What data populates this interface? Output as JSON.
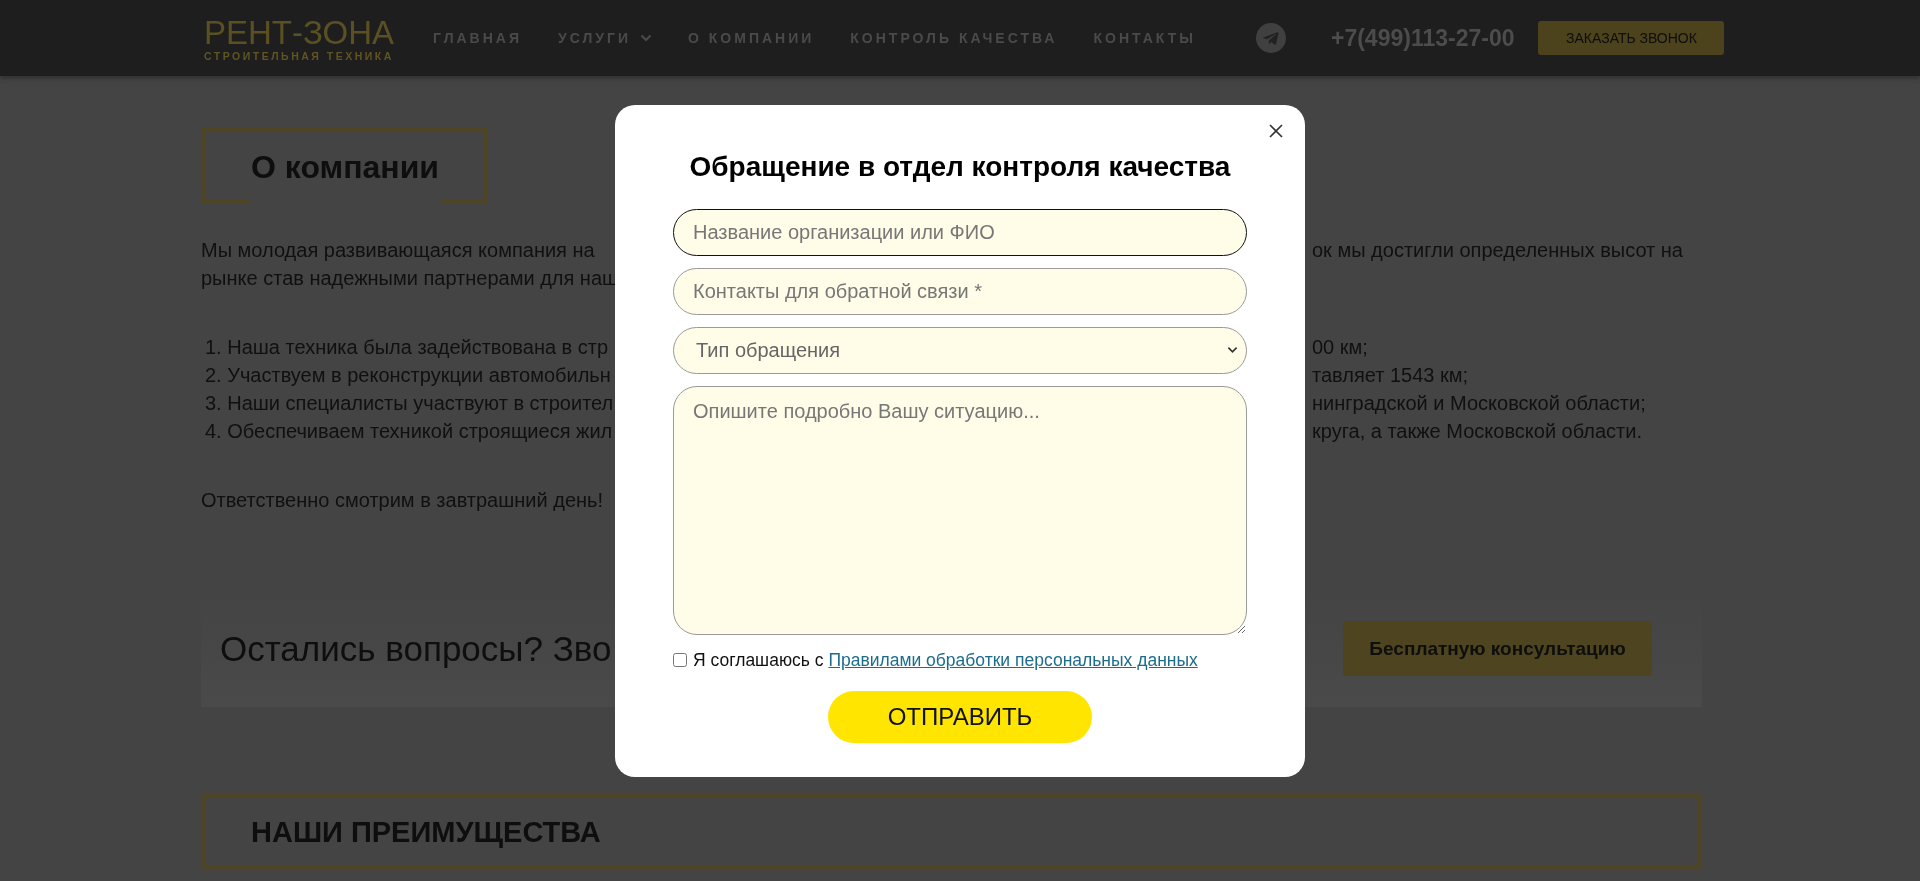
{
  "header": {
    "logo": {
      "name": "РЕНТ-ЗОНА",
      "tagline": "СТРОИТЕЛЬНАЯ ТЕХНИКА"
    },
    "nav": [
      {
        "label": "ГЛАВНАЯ",
        "has_dropdown": false
      },
      {
        "label": "УСЛУГИ",
        "has_dropdown": true
      },
      {
        "label": "О КОМПАНИИ",
        "has_dropdown": false
      },
      {
        "label": "КОНТРОЛЬ КАЧЕСТВА",
        "has_dropdown": false
      },
      {
        "label": "КОНТАКТЫ",
        "has_dropdown": false
      }
    ],
    "phone": "+7(499)113-27-00",
    "callback_button": "ЗАКАЗАТЬ ЗВОНОК"
  },
  "about": {
    "heading": "О компании",
    "intro_lines": [
      {
        "left": "Мы молодая развивающаяся компания на",
        "right": "ок мы достигли определенных высот на"
      },
      {
        "left": "рынке став надежными партнерами для наш"
      }
    ],
    "list_lines": [
      {
        "left": "1. Наша техника была задействована в стр",
        "right": "00 км;"
      },
      {
        "left": "2. Участвуем в реконструкции автомобильн",
        "right": "тавляет 1543 км;"
      },
      {
        "left": "3. Наши специалисты участвуют в строител",
        "right": "нинградской и Московской области;"
      },
      {
        "left": "4. Обеспечиваем техникой строящиеся жил",
        "right": "круга, а также Московской области."
      }
    ],
    "closing": "Ответственно смотрим в завтрашний день!"
  },
  "cta": {
    "text": "Остались вопросы? Зво",
    "button": "Бесплатную консультацию"
  },
  "advantages": {
    "heading": "НАШИ ПРЕИМУЩЕСТВА"
  },
  "modal": {
    "title": "Обращение в отдел контроля качества",
    "fields": [
      {
        "kind": "input",
        "placeholder": "Название организации или ФИО",
        "focused": true
      },
      {
        "kind": "input",
        "placeholder": "Контакты для обратной связи *",
        "focused": false
      },
      {
        "kind": "select",
        "value": "Тип обращения",
        "focused": false
      },
      {
        "kind": "textarea",
        "placeholder": "Опишите подробно Вашу ситуацию...",
        "focused": false
      }
    ],
    "consent": {
      "text": "Я соглашаюсь с",
      "link": "Правилами обработки персональных данных",
      "checked": false
    },
    "submit": "ОТПРАВИТЬ"
  }
}
